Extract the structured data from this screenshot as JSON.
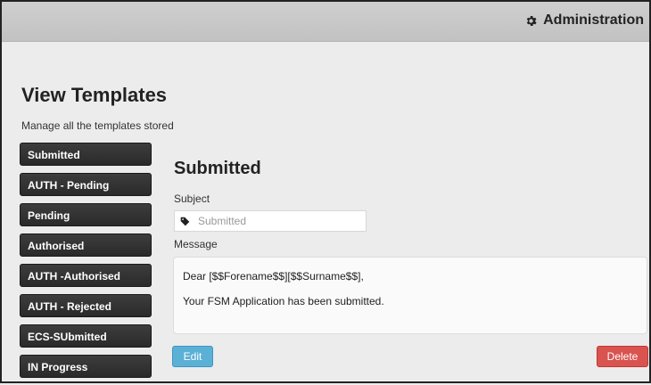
{
  "header": {
    "admin_label": "Administration",
    "admin_icon": "gear-icon"
  },
  "page": {
    "title": "View Templates",
    "description": "Manage all the templates stored"
  },
  "sidebar": {
    "items": [
      {
        "label": "Submitted"
      },
      {
        "label": "AUTH - Pending"
      },
      {
        "label": "Pending"
      },
      {
        "label": "Authorised"
      },
      {
        "label": "AUTH -Authorised"
      },
      {
        "label": "AUTH - Rejected"
      },
      {
        "label": "ECS-SUbmitted"
      },
      {
        "label": "IN Progress"
      }
    ]
  },
  "template": {
    "title": "Submitted",
    "subject_label": "Subject",
    "subject_placeholder": "Submitted",
    "subject_icon": "tag-icon",
    "message_label": "Message",
    "message_lines": [
      "Dear [$$Forename$$][$$Surname$$],",
      "Your FSM Application has been submitted."
    ]
  },
  "actions": {
    "edit_label": "Edit",
    "delete_label": "Delete"
  },
  "colors": {
    "edit_button": "#5bb0d6",
    "delete_button": "#d9534f",
    "sidebar_button": "#333333",
    "header_bar": "#c8c8c8"
  }
}
